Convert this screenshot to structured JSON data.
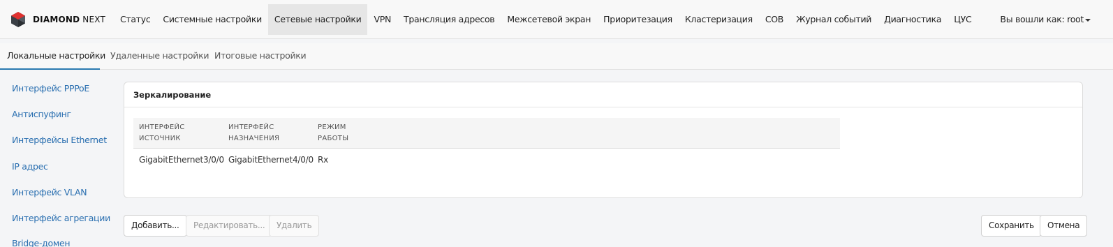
{
  "brand": {
    "name_bold": "DIAMOND",
    "name_rest": " NEXT"
  },
  "nav": {
    "items": [
      {
        "label": "Статус"
      },
      {
        "label": "Системные настройки"
      },
      {
        "label": "Сетевые настройки",
        "active": true
      },
      {
        "label": "VPN"
      },
      {
        "label": "Трансляция адресов"
      },
      {
        "label": "Межсетевой экран"
      },
      {
        "label": "Приоритезация"
      },
      {
        "label": "Кластеризация"
      },
      {
        "label": "СОВ"
      },
      {
        "label": "Журнал событий"
      },
      {
        "label": "Диагностика"
      },
      {
        "label": "ЦУС"
      }
    ],
    "user": "Вы вошли как: root"
  },
  "subtabs": [
    {
      "label": "Локальные настройки",
      "active": true
    },
    {
      "label": "Удаленные настройки"
    },
    {
      "label": "Итоговые настройки"
    }
  ],
  "sidebar": {
    "items": [
      {
        "label": "Интерфейс PPPoE"
      },
      {
        "label": "Антиспуфинг"
      },
      {
        "label": "Интерфейсы Ethernet"
      },
      {
        "label": "IP адрес"
      },
      {
        "label": "Интерфейс VLAN"
      },
      {
        "label": "Интерфейс агрегации"
      },
      {
        "label": "Bridge-домен"
      }
    ]
  },
  "panel": {
    "title": "Зеркалирование",
    "columns": [
      {
        "line1": "Интерфейс",
        "line2": "источник"
      },
      {
        "line1": "Интерфейс",
        "line2": "назначения"
      },
      {
        "line1": "Режим",
        "line2": "работы"
      }
    ],
    "rows": [
      [
        "GigabitEthernet3/0/0",
        "GigabitEthernet4/0/0",
        "Rx"
      ]
    ]
  },
  "buttons": {
    "add": "Добавить...",
    "edit": "Редактировать...",
    "delete": "Удалить",
    "save": "Сохранить",
    "cancel": "Отмена"
  },
  "colors": {
    "accent": "#2a7ab0",
    "link": "#2a6fb0"
  }
}
